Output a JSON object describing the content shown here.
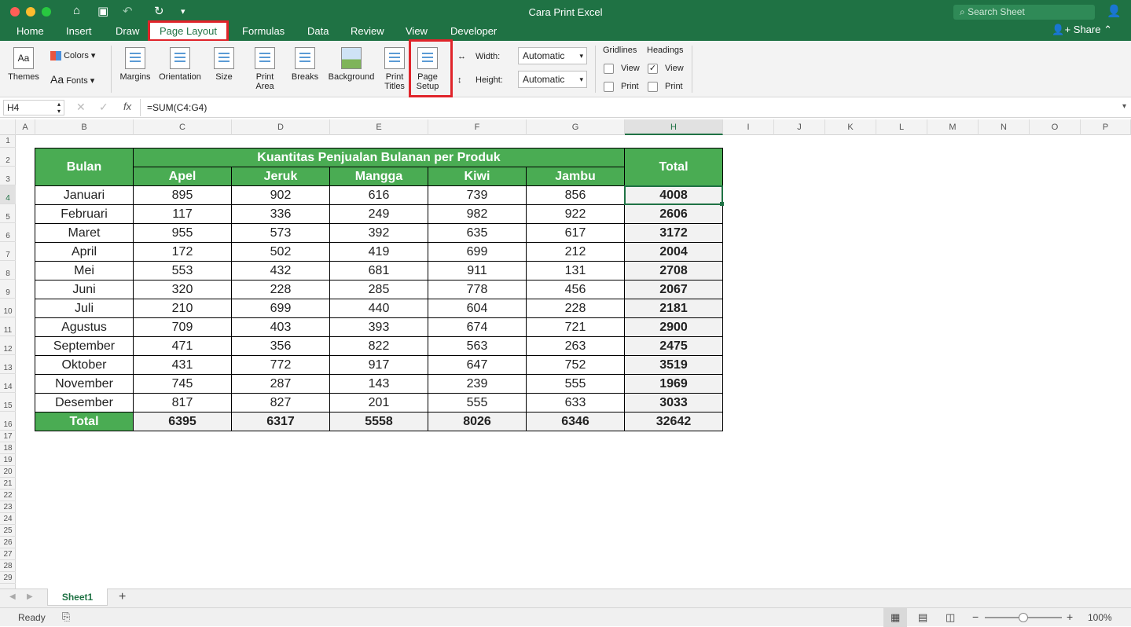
{
  "window": {
    "title": "Cara Print Excel",
    "search_placeholder": "Search Sheet"
  },
  "tabs": [
    "Home",
    "Insert",
    "Draw",
    "Page Layout",
    "Formulas",
    "Data",
    "Review",
    "View",
    "Developer"
  ],
  "share_label": "Share",
  "ribbon": {
    "themes": "Themes",
    "colors": "Colors",
    "fonts": "Fonts",
    "margins": "Margins",
    "orientation": "Orientation",
    "size": "Size",
    "print_area": "Print Area",
    "breaks": "Breaks",
    "background": "Background",
    "print_titles": "Print Titles",
    "page_setup": "Page Setup",
    "width_label": "Width:",
    "width_value": "Automatic",
    "height_label": "Height:",
    "height_value": "Automatic",
    "gridlines": "Gridlines",
    "headings": "Headings",
    "view": "View",
    "print": "Print"
  },
  "formula_bar": {
    "name_box": "H4",
    "fx": "fx",
    "formula": "=SUM(C4:G4)"
  },
  "columns": [
    "A",
    "B",
    "C",
    "D",
    "E",
    "F",
    "G",
    "H",
    "I",
    "J",
    "K",
    "L",
    "M",
    "N",
    "O",
    "P"
  ],
  "rows": [
    "1",
    "2",
    "3",
    "4",
    "5",
    "6",
    "7",
    "8",
    "9",
    "10",
    "11",
    "12",
    "13",
    "14",
    "15",
    "16",
    "17",
    "18",
    "19",
    "20",
    "21",
    "22",
    "23",
    "24",
    "25",
    "26",
    "27",
    "28",
    "29"
  ],
  "table": {
    "bulan_header": "Bulan",
    "group_header": "Kuantitas Penjualan Bulanan per Produk",
    "total_header": "Total",
    "products": [
      "Apel",
      "Jeruk",
      "Mangga",
      "Kiwi",
      "Jambu"
    ],
    "data": [
      [
        "Januari",
        "895",
        "902",
        "616",
        "739",
        "856",
        "4008"
      ],
      [
        "Februari",
        "117",
        "336",
        "249",
        "982",
        "922",
        "2606"
      ],
      [
        "Maret",
        "955",
        "573",
        "392",
        "635",
        "617",
        "3172"
      ],
      [
        "April",
        "172",
        "502",
        "419",
        "699",
        "212",
        "2004"
      ],
      [
        "Mei",
        "553",
        "432",
        "681",
        "911",
        "131",
        "2708"
      ],
      [
        "Juni",
        "320",
        "228",
        "285",
        "778",
        "456",
        "2067"
      ],
      [
        "Juli",
        "210",
        "699",
        "440",
        "604",
        "228",
        "2181"
      ],
      [
        "Agustus",
        "709",
        "403",
        "393",
        "674",
        "721",
        "2900"
      ],
      [
        "September",
        "471",
        "356",
        "822",
        "563",
        "263",
        "2475"
      ],
      [
        "Oktober",
        "431",
        "772",
        "917",
        "647",
        "752",
        "3519"
      ],
      [
        "November",
        "745",
        "287",
        "143",
        "239",
        "555",
        "1969"
      ],
      [
        "Desember",
        "817",
        "827",
        "201",
        "555",
        "633",
        "3033"
      ]
    ],
    "total_row": [
      "Total",
      "6395",
      "6317",
      "5558",
      "8026",
      "6346",
      "32642"
    ]
  },
  "sheet_tab": "Sheet1",
  "status": {
    "ready": "Ready",
    "zoom": "100%"
  }
}
